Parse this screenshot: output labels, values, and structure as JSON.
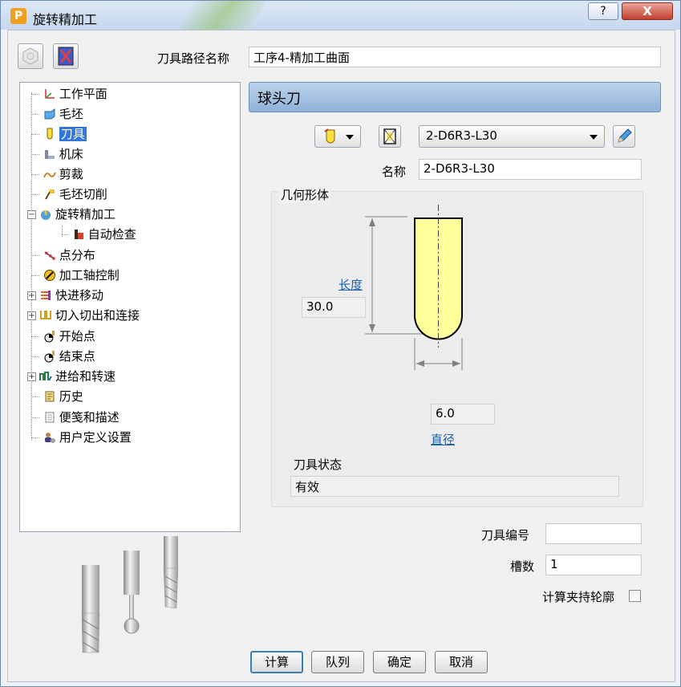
{
  "window": {
    "title": "旋转精加工",
    "help_label": "?",
    "close_label": "X",
    "app_icon_letter": "P"
  },
  "toolpath": {
    "name_label": "刀具路径名称",
    "name_value": "工序4-精加工曲面"
  },
  "tree": {
    "items": [
      {
        "label": "工作平面",
        "icon": "workplane-icon"
      },
      {
        "label": "毛坯",
        "icon": "block-icon"
      },
      {
        "label": "刀具",
        "icon": "tool-icon",
        "selected": true
      },
      {
        "label": "机床",
        "icon": "machine-icon"
      },
      {
        "label": "剪裁",
        "icon": "limit-icon"
      },
      {
        "label": "毛坯切削",
        "icon": "stock-cut-icon"
      },
      {
        "label": "旋转精加工",
        "icon": "rotary-finish-icon",
        "expanded": true
      },
      {
        "label": "自动检查",
        "icon": "auto-check-icon",
        "child": true
      },
      {
        "label": "点分布",
        "icon": "point-distribution-icon"
      },
      {
        "label": "加工轴控制",
        "icon": "axis-control-icon"
      },
      {
        "label": "快进移动",
        "icon": "rapid-move-icon",
        "collapsed": true
      },
      {
        "label": "切入切出和连接",
        "icon": "leads-links-icon",
        "collapsed": true
      },
      {
        "label": "开始点",
        "icon": "start-point-icon"
      },
      {
        "label": "结束点",
        "icon": "end-point-icon"
      },
      {
        "label": "进给和转速",
        "icon": "feeds-speeds-icon",
        "collapsed": true
      },
      {
        "label": "历史",
        "icon": "history-icon"
      },
      {
        "label": "便笺和描述",
        "icon": "notes-icon"
      },
      {
        "label": "用户定义设置",
        "icon": "user-settings-icon"
      }
    ]
  },
  "tool_panel": {
    "header": "球头刀",
    "tool_selected": "2-D6R3-L30",
    "name_label": "名称",
    "name_value": "2-D6R3-L30",
    "geometry_label": "几何形体",
    "length_label": "长度",
    "length_value": "30.0",
    "diameter_label": "直径",
    "diameter_value": "6.0",
    "state_label": "刀具状态",
    "state_value": "有效",
    "tool_number_label": "刀具编号",
    "tool_number_value": "",
    "flutes_label": "槽数",
    "flutes_value": "1",
    "holder_profile_label": "计算夹持轮廓",
    "holder_profile_checked": false
  },
  "buttons": {
    "calculate": "计算",
    "queue": "队列",
    "ok": "确定",
    "cancel": "取消"
  },
  "colors": {
    "tool_fill": "#ffff99",
    "header_blue": "#8fb2d8",
    "selection": "#3377dd",
    "link": "#1a5fb0"
  }
}
